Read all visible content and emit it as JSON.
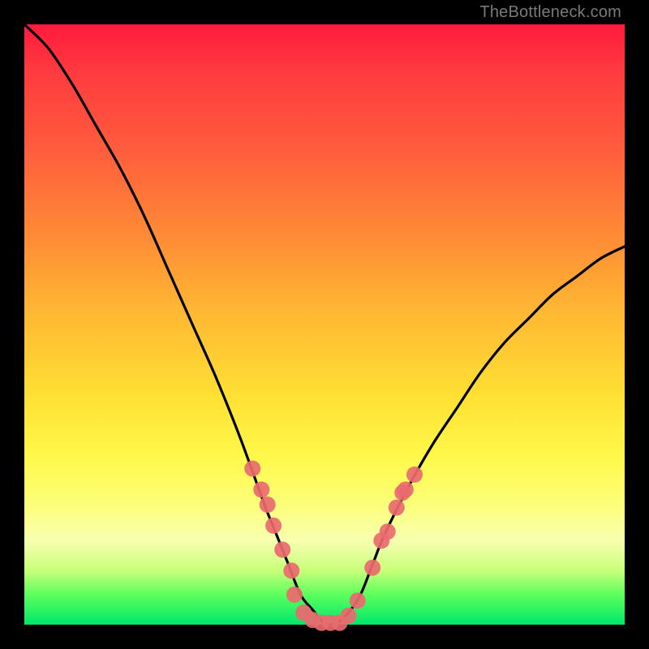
{
  "watermark": "TheBottleneck.com",
  "colors": {
    "frame": "#000000",
    "curve_stroke": "#000000",
    "marker_fill": "#e96a6f",
    "marker_stroke": "#d94f57"
  },
  "chart_data": {
    "type": "line",
    "title": "",
    "xlabel": "",
    "ylabel": "",
    "xlim": [
      0,
      100
    ],
    "ylim": [
      0,
      100
    ],
    "grid": false,
    "legend": false,
    "series": [
      {
        "name": "bottleneck-curve",
        "x": [
          0,
          4,
          8,
          12,
          16,
          20,
          24,
          28,
          32,
          36,
          40,
          42,
          44,
          46,
          48,
          50,
          52,
          54,
          56,
          58,
          60,
          64,
          68,
          72,
          76,
          80,
          84,
          88,
          92,
          96,
          100
        ],
        "y": [
          100,
          96,
          90,
          83,
          76,
          68,
          59,
          50,
          41,
          31,
          20,
          15,
          10,
          5,
          2.5,
          0.3,
          0.3,
          2,
          5,
          10,
          15,
          23,
          30,
          36,
          42,
          47,
          51,
          55,
          58,
          61,
          63
        ]
      }
    ],
    "markers": [
      {
        "x": 38.0,
        "y": 26.0
      },
      {
        "x": 39.5,
        "y": 22.5
      },
      {
        "x": 40.5,
        "y": 20.0
      },
      {
        "x": 41.5,
        "y": 16.5
      },
      {
        "x": 43.0,
        "y": 12.5
      },
      {
        "x": 44.5,
        "y": 9.0
      },
      {
        "x": 45.0,
        "y": 5.0
      },
      {
        "x": 46.5,
        "y": 2.0
      },
      {
        "x": 48.0,
        "y": 0.8
      },
      {
        "x": 49.5,
        "y": 0.3
      },
      {
        "x": 51.0,
        "y": 0.3
      },
      {
        "x": 52.5,
        "y": 0.3
      },
      {
        "x": 54.0,
        "y": 1.5
      },
      {
        "x": 55.5,
        "y": 4.0
      },
      {
        "x": 58.0,
        "y": 9.5
      },
      {
        "x": 59.5,
        "y": 14.0
      },
      {
        "x": 60.5,
        "y": 15.5
      },
      {
        "x": 62.0,
        "y": 19.5
      },
      {
        "x": 63.0,
        "y": 22.0
      },
      {
        "x": 63.5,
        "y": 22.5
      },
      {
        "x": 65.0,
        "y": 25.0
      }
    ]
  }
}
